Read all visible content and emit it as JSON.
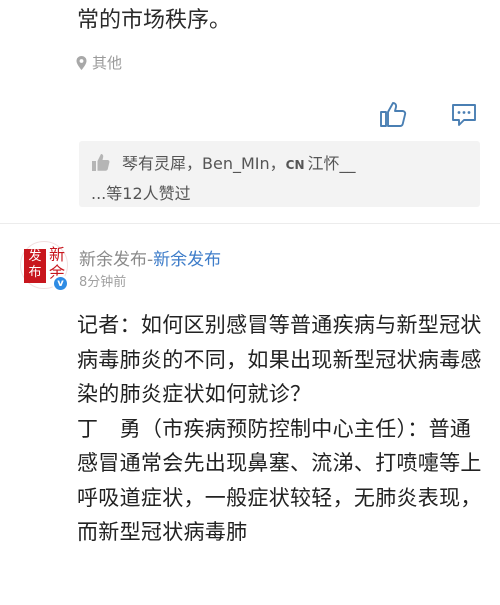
{
  "previous_post": {
    "text_tail": "常的市场秩序。",
    "location": "其他"
  },
  "actions": {
    "like_icon": "thumbs-up-icon",
    "comment_icon": "comment-icon"
  },
  "likes": {
    "icon": "thumbs-up-icon",
    "likers_line": "琴有灵犀，Ben_MIn，",
    "cn_badge": "CN",
    "last_liker": "江怀__",
    "count_text": "...等12人赞过"
  },
  "post": {
    "author_name": "新余发布",
    "separator": "-",
    "source_name": "新余发布",
    "time": "8分钟前",
    "avatar_seal_text": "发布",
    "avatar_calli_text": "新余",
    "verified_mark": "v",
    "body_lines": [
      "记者：如何区别感冒等普通疾病与新型冠状病毒肺炎的不同，如果出现新型冠状病毒感染的肺炎症状如何就诊？",
      "丁　勇（市疾病预防控制中心主任）：普通感冒通常会先出现鼻塞、流涕、打喷嚏等上呼吸道症状，一般症状较轻，无肺炎表现，而新型冠状病毒肺"
    ]
  },
  "colors": {
    "link_blue": "#3d7cc9",
    "avatar_red": "#c8161d",
    "verified_blue": "#2f8ce4"
  }
}
